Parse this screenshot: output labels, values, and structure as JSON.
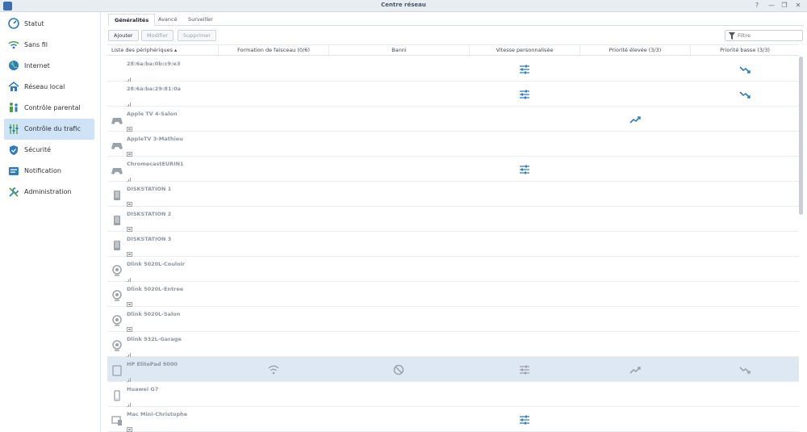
{
  "window": {
    "title": "Centre réseau",
    "help": "?",
    "minimize": "—",
    "restore": "❐",
    "close": "✕"
  },
  "sidebar": {
    "items": [
      {
        "label": "Statut",
        "icon": "status-icon",
        "color": "#2e7bc4"
      },
      {
        "label": "Sans fil",
        "icon": "wifi-icon",
        "color": "#2e7bc4"
      },
      {
        "label": "Internet",
        "icon": "globe-icon",
        "color": "#2e7bc4"
      },
      {
        "label": "Réseau local",
        "icon": "home-network-icon",
        "color": "#2e7bc4"
      },
      {
        "label": "Contrôle parental",
        "icon": "parental-icon",
        "color": "#2e7bc4"
      },
      {
        "label": "Contrôle du trafic",
        "icon": "traffic-control-icon",
        "color": "#2e7bc4",
        "active": true
      },
      {
        "label": "Sécurité",
        "icon": "shield-icon",
        "color": "#2e7bc4"
      },
      {
        "label": "Notification",
        "icon": "notification-icon",
        "color": "#2e7bc4"
      },
      {
        "label": "Administration",
        "icon": "tools-icon",
        "color": "#2e7bc4"
      }
    ]
  },
  "tabs": [
    {
      "label": "Généralités",
      "active": true
    },
    {
      "label": "Avancé"
    },
    {
      "label": "Surveiller"
    }
  ],
  "toolbar": {
    "add": "Ajouter",
    "edit": "Modifier",
    "delete": "Supprimer",
    "filter_placeholder": "Filtre"
  },
  "table": {
    "columns": [
      "Liste des périphériques ▴",
      "Formation de faisceau (0/6)",
      "Banni",
      "Vitesse personnalisée",
      "Priorité élevée (3/3)",
      "Priorité basse (3/3)"
    ],
    "rows": [
      {
        "name": "28:6a:ba:0b:c9:e3",
        "device": "none",
        "conn": "wifi",
        "custom_speed": true,
        "low": true
      },
      {
        "name": "28:6a:ba:29:81:0a",
        "device": "none",
        "conn": "wifi",
        "custom_speed": true,
        "low": true
      },
      {
        "name": "Apple TV 4-Salon",
        "device": "gamepad-icon",
        "conn": "lan",
        "high": true
      },
      {
        "name": "AppleTV 3-Mathieu",
        "device": "gamepad-icon",
        "conn": "lan"
      },
      {
        "name": "ChromecastEURIN1",
        "device": "gamepad-icon",
        "conn": "wifi",
        "custom_speed": true
      },
      {
        "name": "DISKSTATION 1",
        "device": "nas-icon",
        "conn": "lan"
      },
      {
        "name": "DISKSTATION 2",
        "device": "nas-icon",
        "conn": "lan"
      },
      {
        "name": "DISKSTATION 3",
        "device": "nas-icon",
        "conn": "lan"
      },
      {
        "name": "Dlink 5020L-Couloir",
        "device": "webcam-icon",
        "conn": "wifi"
      },
      {
        "name": "Dlink 5020L-Entree",
        "device": "webcam-icon",
        "conn": "lan"
      },
      {
        "name": "Dlink 5020L-Salon",
        "device": "webcam-icon",
        "conn": "lan"
      },
      {
        "name": "Dlink 932L-Garage",
        "device": "webcam-icon",
        "conn": "wifi"
      },
      {
        "name": "HP ElitePad 9000",
        "device": "tablet-icon",
        "conn": "wifi",
        "selected": true,
        "hover_actions": true
      },
      {
        "name": "Huawei G7",
        "device": "phone-icon",
        "conn": "wifi"
      },
      {
        "name": "Mac Mini-Christophe",
        "device": "computer-icon",
        "conn": "lan",
        "custom_speed": true
      }
    ]
  }
}
